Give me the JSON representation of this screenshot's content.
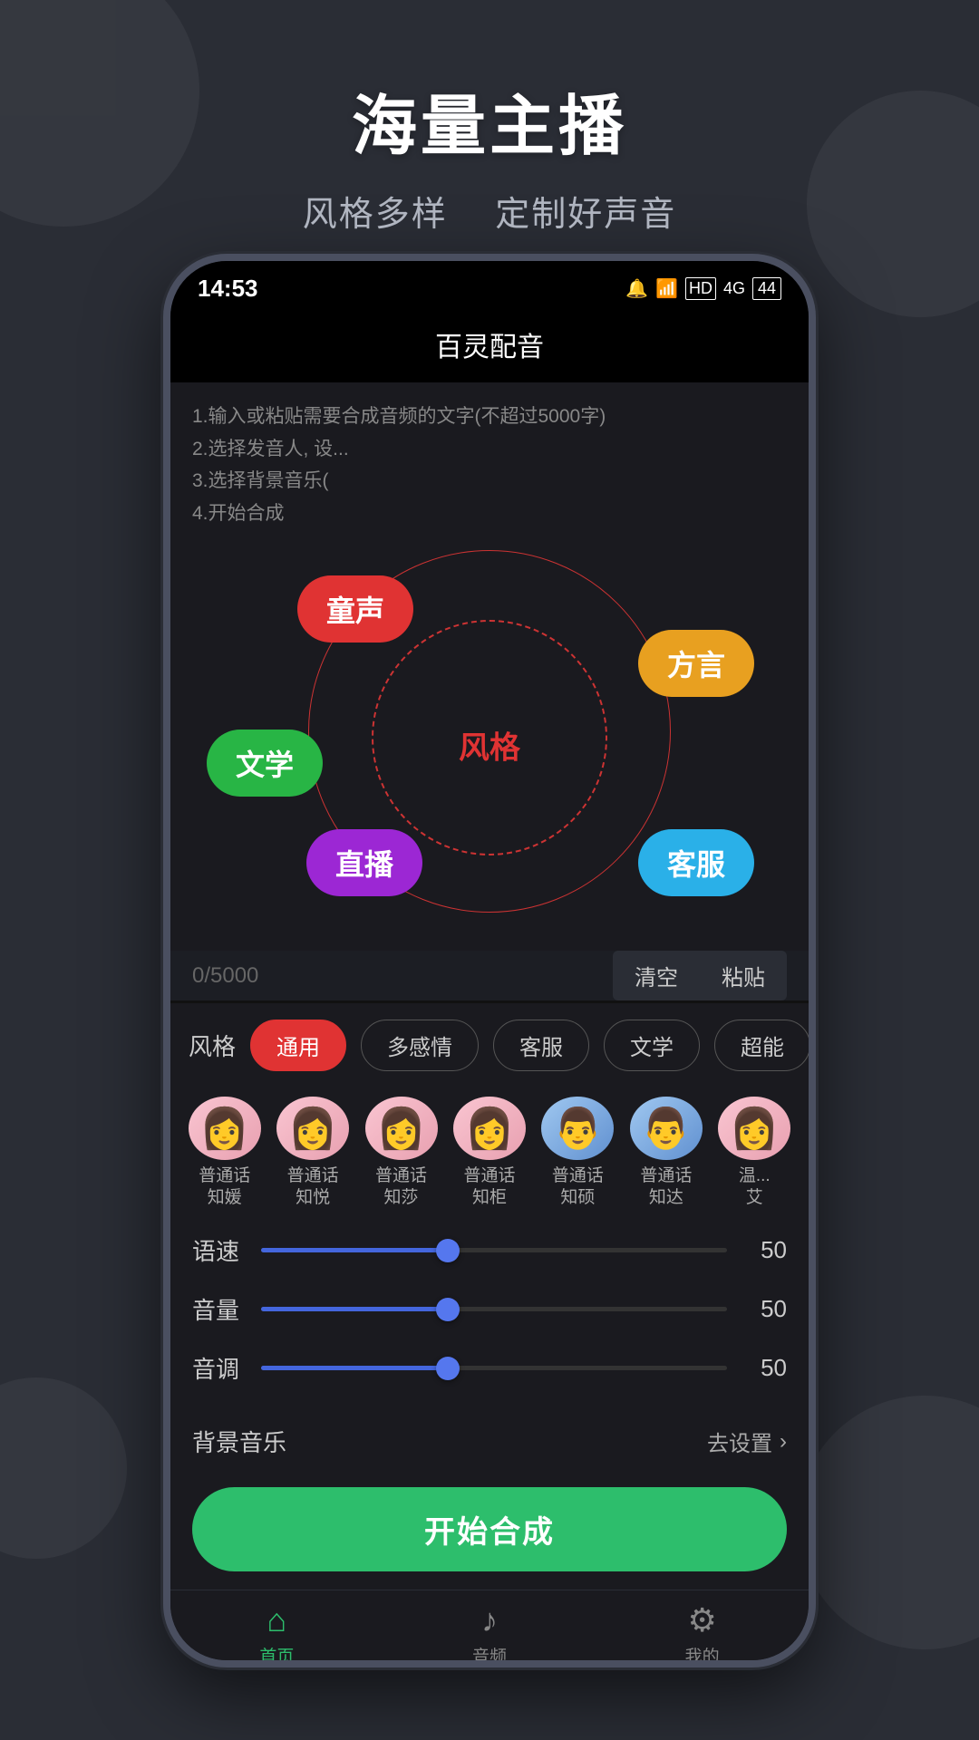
{
  "page": {
    "background_color": "#2a2d35"
  },
  "header": {
    "main_title": "海量主播",
    "sub_title_part1": "风格多样",
    "sub_title_part2": "定制好声音"
  },
  "status_bar": {
    "time": "14:53",
    "icons": "🔔 📶 HD 4G 🔋"
  },
  "app": {
    "title": "百灵配音"
  },
  "instructions": {
    "line1": "1.输入或粘贴需要合成音频的文字(不超过5000字)",
    "line2": "2.选择发音人, 设...",
    "line3": "3.选择背景音乐(",
    "line4": "4.开始合成"
  },
  "wheel": {
    "center_label": "风格",
    "bubbles": [
      {
        "id": "tongsheng",
        "label": "童声",
        "color": "#e03333"
      },
      {
        "id": "fangyan",
        "label": "方言",
        "color": "#e8a020"
      },
      {
        "id": "wenxue",
        "label": "文学",
        "color": "#28b545"
      },
      {
        "id": "zhibo",
        "label": "直播",
        "color": "#9c27d4"
      },
      {
        "id": "kefu",
        "label": "客服",
        "color": "#2ab0e8"
      }
    ]
  },
  "counter": {
    "value": "0/5000"
  },
  "buttons": {
    "clear": "清空",
    "paste": "粘贴"
  },
  "style_filters": {
    "label": "风格",
    "items": [
      {
        "id": "tongyong",
        "label": "通用",
        "active": true
      },
      {
        "id": "duogangqing",
        "label": "多感情",
        "active": false
      },
      {
        "id": "kefu",
        "label": "客服",
        "active": false
      },
      {
        "id": "wenxue",
        "label": "文学",
        "active": false
      },
      {
        "id": "chao",
        "label": "超能",
        "active": false
      }
    ]
  },
  "voices": [
    {
      "id": "v1",
      "name": "普通话\n知媛",
      "gender": "female"
    },
    {
      "id": "v2",
      "name": "普通话\n知悦",
      "gender": "female"
    },
    {
      "id": "v3",
      "name": "普通话\n知莎",
      "gender": "female"
    },
    {
      "id": "v4",
      "name": "普通话\n知柜",
      "gender": "female"
    },
    {
      "id": "v5",
      "name": "普通话\n知硕",
      "gender": "male"
    },
    {
      "id": "v6",
      "name": "普通话\n知达",
      "gender": "male"
    },
    {
      "id": "v7",
      "name": "温...\n艾",
      "gender": "female"
    }
  ],
  "sliders": [
    {
      "id": "speed",
      "label": "语速",
      "value": 50,
      "fill_pct": 40
    },
    {
      "id": "volume",
      "label": "音量",
      "value": 50,
      "fill_pct": 40
    },
    {
      "id": "pitch",
      "label": "音调",
      "value": 50,
      "fill_pct": 40
    }
  ],
  "bg_music": {
    "label": "背景音乐",
    "setting": "去设置"
  },
  "start_button": {
    "label": "开始合成"
  },
  "bottom_nav": [
    {
      "id": "home",
      "icon": "🏠",
      "label": "首页",
      "active": true
    },
    {
      "id": "music",
      "icon": "🎵",
      "label": "音频",
      "active": false
    },
    {
      "id": "user",
      "icon": "👤",
      "label": "我的",
      "active": false
    }
  ]
}
